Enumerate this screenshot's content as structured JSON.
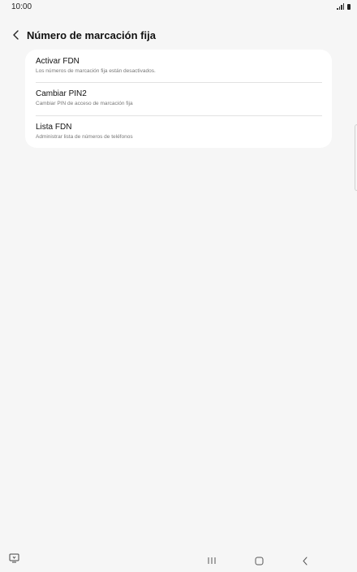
{
  "status_bar": {
    "time": "10:00"
  },
  "header": {
    "title": "Número de marcación fija"
  },
  "settings": {
    "items": [
      {
        "title": "Activar FDN",
        "subtitle": "Los números de marcación fija están desactivados."
      },
      {
        "title": "Cambiar PIN2",
        "subtitle": "Cambiar PIN de acceso de marcación fija"
      },
      {
        "title": "Lista FDN",
        "subtitle": "Administrar lista de números de teléfonos"
      }
    ]
  },
  "icons": {
    "back": "chevron-left-icon",
    "signal": "signal-icon",
    "battery": "battery-icon",
    "keyboard": "keyboard-toggle-icon",
    "recents": "recents-icon",
    "home": "home-icon",
    "nav_back": "nav-back-icon"
  },
  "colors": {
    "background": "#f6f6f6",
    "card": "#ffffff"
  }
}
